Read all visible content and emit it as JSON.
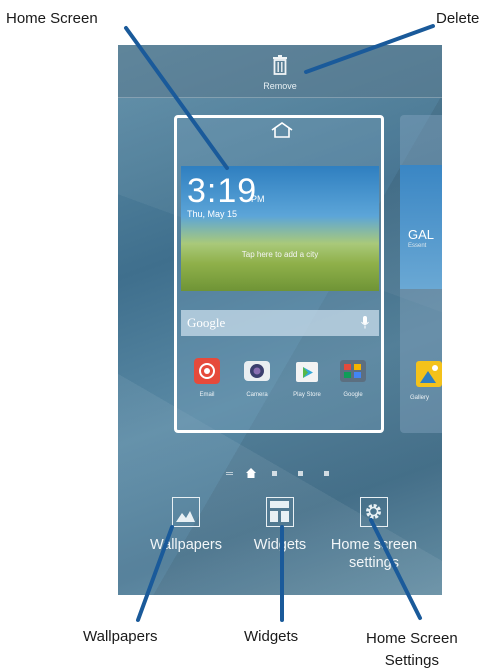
{
  "callouts": {
    "home_screen": "Home Screen",
    "delete": "Delete",
    "wallpapers": "Wallpapers",
    "widgets": "Widgets",
    "home_screen_settings": "Home Screen\nSettings"
  },
  "phone": {
    "top_bar": {
      "remove_label": "Remove",
      "icon": "trash-icon"
    },
    "home_card": {
      "home_icon": "home-icon",
      "clock": "3:19",
      "ampm": "PM",
      "date": "Thu, May 15",
      "city_hint": "Tap here to add a city",
      "search_brand": "Google",
      "mic_icon": "mic-icon",
      "apps": [
        {
          "label": "Email",
          "icon": "email-icon",
          "color": "#e64a3b"
        },
        {
          "label": "Camera",
          "icon": "camera-icon",
          "color": "#ffffff"
        },
        {
          "label": "Play Store",
          "icon": "play-store-icon",
          "color": "#ffffff"
        },
        {
          "label": "Google",
          "icon": "google-folder-icon",
          "color": "#ffffff"
        }
      ]
    },
    "next_card": {
      "title": "GAL",
      "subtitle": "Essent",
      "app_label": "Gallery",
      "app_icon": "gallery-icon"
    },
    "page_indicator": {
      "active": 1,
      "count": 4
    },
    "bottom_buttons": [
      {
        "label": "Wallpapers",
        "icon": "wallpaper-icon"
      },
      {
        "label": "Widgets",
        "icon": "widgets-icon"
      },
      {
        "label": "Home screen settings",
        "icon": "settings-gear-icon"
      }
    ]
  },
  "colors": {
    "callout_line": "#1a5a9a",
    "wallpaper": "#4a7894",
    "card_border": "#ffffff"
  }
}
